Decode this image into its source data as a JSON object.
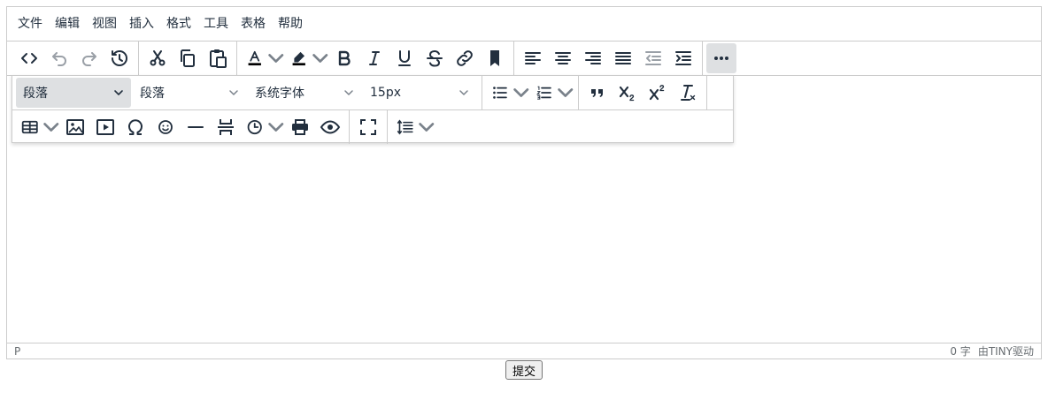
{
  "menubar": {
    "items": [
      "文件",
      "编辑",
      "视图",
      "插入",
      "格式",
      "工具",
      "表格",
      "帮助"
    ]
  },
  "format": {
    "block_selected": "段落",
    "block_format": "段落",
    "font_family": "系统字体",
    "font_size": "15px"
  },
  "statusbar": {
    "path": "P",
    "word_count": "0 字",
    "powered_by": "由TINY驱动"
  },
  "submit_label": "提交",
  "colors": {
    "icon": "#222f3e",
    "border": "#cccccc",
    "active_bg": "#dee0e2"
  }
}
